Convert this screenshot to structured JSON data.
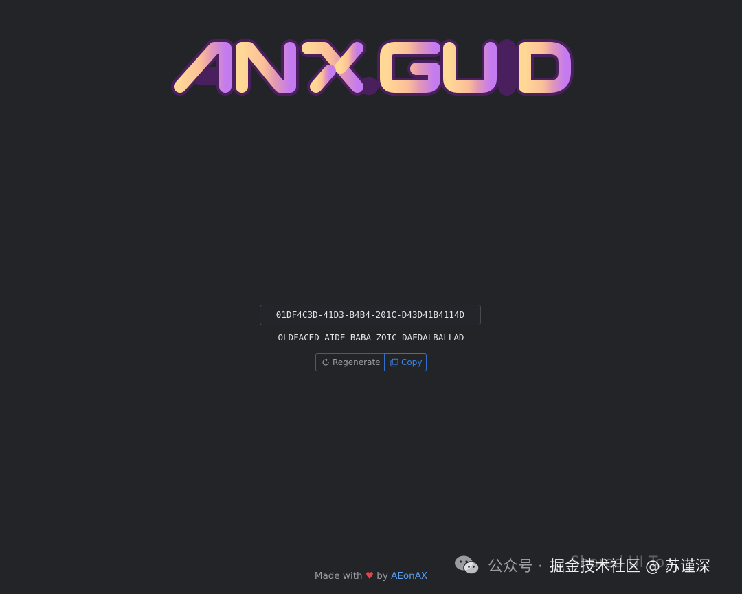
{
  "logo": {
    "text": "ANX.GUID",
    "gradient": [
      "#ffcf94",
      "#f5a89a",
      "#dd90c8",
      "#c47af0"
    ],
    "outline": "#4a1f5e"
  },
  "guid": {
    "value": "01DF4C3D-41D3-B4B4-201C-D43D41B4114D",
    "words": "OLDFACED-AIDE-BABA-ZOIC-DAEDALBALLAD"
  },
  "actions": {
    "regenerate_label": "Regenerate",
    "regenerate_icon": "refresh-icon",
    "copy_label": "Copy",
    "copy_icon": "copy-icon"
  },
  "footer": {
    "made_with": "Made with",
    "heart": "♥",
    "by": "by",
    "author": "AEonAX"
  },
  "watermark": {
    "icon": "wechat-icon",
    "account": "公众号 ·",
    "faint": "Shared UI To...",
    "community": "掘金技术社区 @ 苏谨深"
  },
  "colors": {
    "background": "#222428",
    "accent": "#3b82e8",
    "heart": "#e0474c"
  }
}
